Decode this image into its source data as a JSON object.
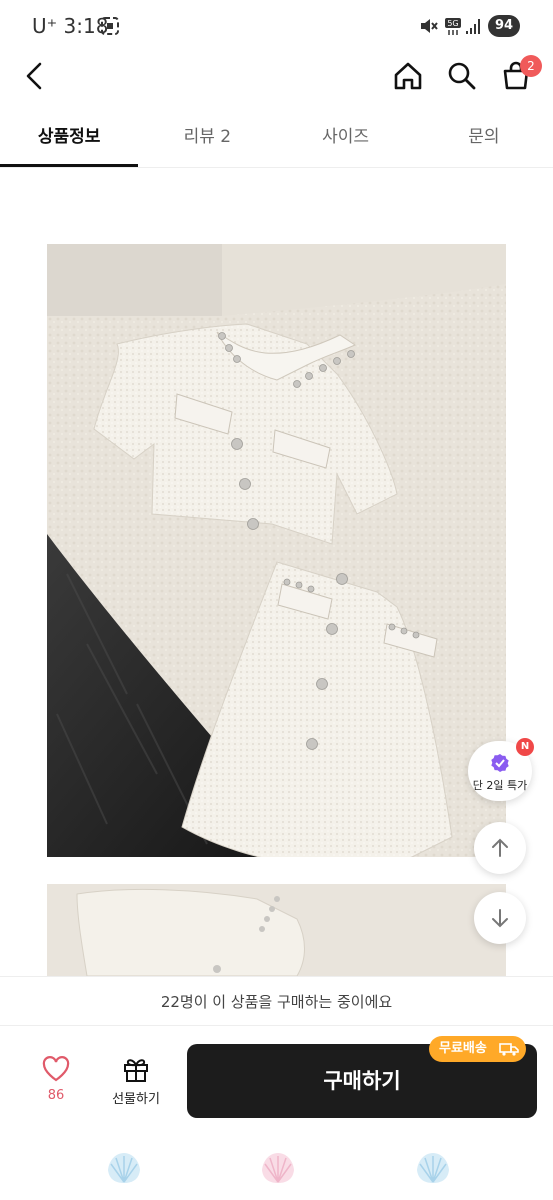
{
  "status": {
    "carrier": "U⁺ 3:18",
    "battery": "94"
  },
  "header": {
    "cart_count": "2"
  },
  "tabs": [
    {
      "label": "상품정보",
      "active": true
    },
    {
      "label": "리뷰 2",
      "active": false
    },
    {
      "label": "사이즈",
      "active": false
    },
    {
      "label": "문의",
      "active": false
    }
  ],
  "promo": {
    "label": "단 2일 특가",
    "badge": "N"
  },
  "buying_text": "22명이 이 상품을 구매하는 중이에요",
  "actions": {
    "like_count": "86",
    "gift_label": "선물하기",
    "buy_label": "구매하기",
    "shipping_tag": "무료배송"
  },
  "colors": {
    "accent": "#f05a5a",
    "buy_button": "#1c1c1c",
    "shipping_tag": "#ffa928",
    "promo_icon": "#8a5cf0"
  }
}
